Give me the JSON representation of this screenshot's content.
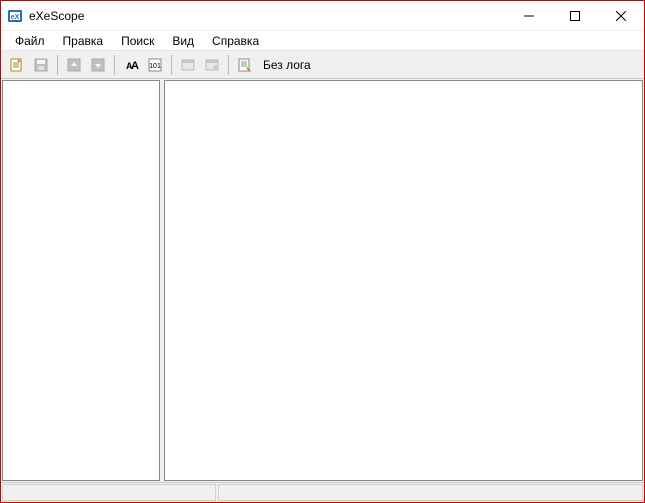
{
  "window": {
    "title": "eXeScope"
  },
  "menu": {
    "file": "Файл",
    "edit": "Правка",
    "search": "Поиск",
    "view": "Вид",
    "help": "Справка"
  },
  "toolbar": {
    "open_icon": "open-file-icon",
    "save_icon": "save-icon",
    "import_icon": "import-icon",
    "export_icon": "export-icon",
    "font_icon": "font-icon",
    "binary_icon": "binary-icon",
    "dialog_icon": "dialog-icon",
    "dialog_test_icon": "dialog-test-icon",
    "log_icon": "log-icon",
    "log_label": "Без лога"
  },
  "icons": {
    "app": "exescope-icon",
    "minimize": "minimize-icon",
    "maximize": "maximize-icon",
    "close": "close-icon"
  }
}
